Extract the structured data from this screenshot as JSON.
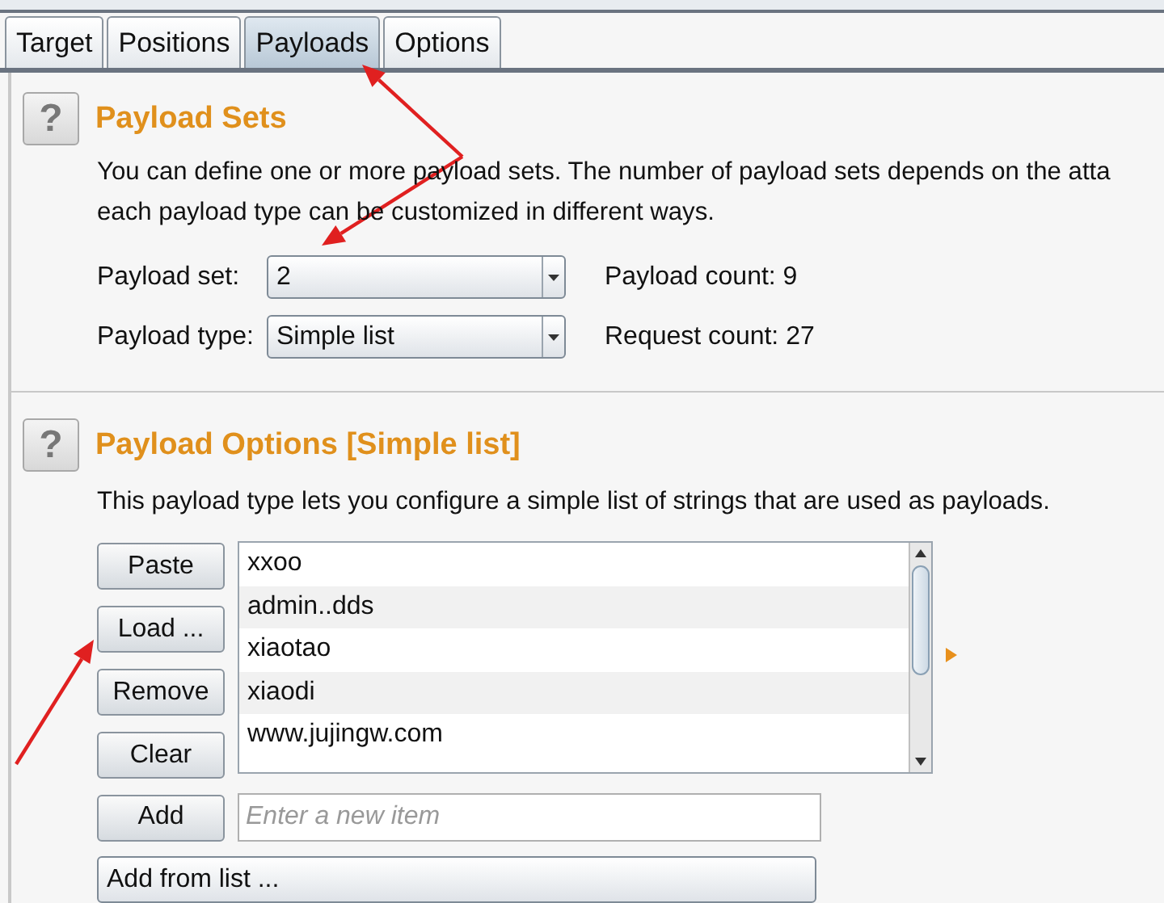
{
  "tabs": [
    {
      "label": "Target",
      "selected": false
    },
    {
      "label": "Positions",
      "selected": false
    },
    {
      "label": "Payloads",
      "selected": true
    },
    {
      "label": "Options",
      "selected": false
    }
  ],
  "payload_sets": {
    "help_icon": "?",
    "title": "Payload Sets",
    "description": [
      "You can define one or more payload sets. The number of payload sets depends on the atta",
      "each payload type can be customized in different ways."
    ],
    "fields": [
      {
        "label": "Payload set:",
        "value": "2",
        "info": "Payload count: 9"
      },
      {
        "label": "Payload type:",
        "value": "Simple list",
        "info": "Request count: 27"
      }
    ]
  },
  "payload_options": {
    "help_icon": "?",
    "title": "Payload Options [Simple list]",
    "description": "This payload type lets you configure a simple list of strings that are used as payloads.",
    "buttons": [
      "Paste",
      "Load ...",
      "Remove",
      "Clear"
    ],
    "items": [
      "xxoo",
      "admin..dds",
      "xiaotao",
      "xiaodi",
      "www.jujingw.com"
    ],
    "add_button": "Add",
    "new_item": {
      "placeholder": "Enter a new item"
    },
    "add_from_list": "Add from list ..."
  }
}
